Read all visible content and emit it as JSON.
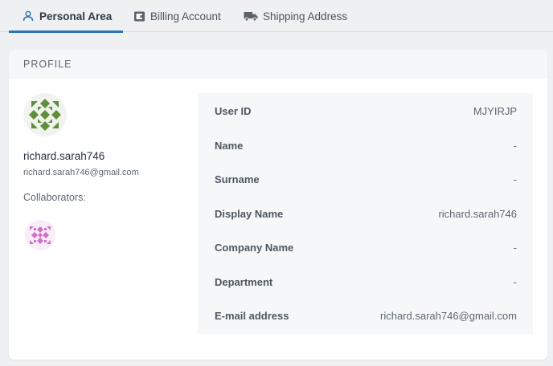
{
  "tabs": [
    {
      "label": "Personal Area",
      "icon": "user-icon",
      "active": true
    },
    {
      "label": "Billing Account",
      "icon": "wallet-icon",
      "active": false
    },
    {
      "label": "Shipping Address",
      "icon": "truck-icon",
      "active": false
    }
  ],
  "colors": {
    "accent": "#2f75b5",
    "avatar": "#5f8f3a",
    "collaborator": "#d26fcb"
  },
  "profile": {
    "header": "PROFILE",
    "username": "richard.sarah746",
    "email": "richard.sarah746@gmail.com",
    "collaborators_label": "Collaborators:",
    "fields": [
      {
        "label": "User ID",
        "value": "MJYIRJP"
      },
      {
        "label": "Name",
        "value": "-"
      },
      {
        "label": "Surname",
        "value": "-"
      },
      {
        "label": "Display Name",
        "value": "richard.sarah746"
      },
      {
        "label": "Company Name",
        "value": "-"
      },
      {
        "label": "Department",
        "value": "-"
      },
      {
        "label": "E-mail address",
        "value": "richard.sarah746@gmail.com"
      }
    ]
  }
}
